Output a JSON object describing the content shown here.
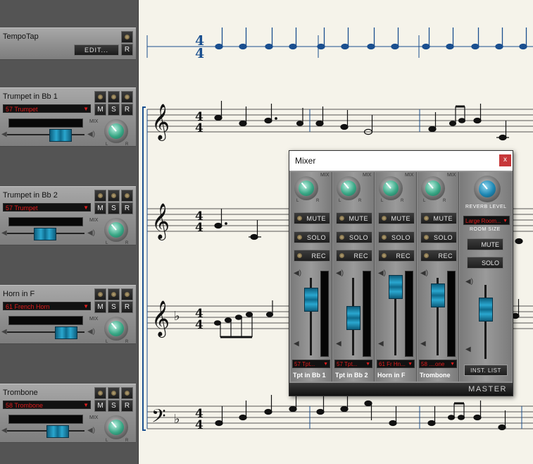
{
  "tempo_track": {
    "name": "TempoTap",
    "edit_label": "EDIT...",
    "r_label": "R"
  },
  "tracks": [
    {
      "name": "Trumpet in Bb 1",
      "patch": "57 Trumpet",
      "m": "M",
      "s": "S",
      "r": "R",
      "mix": "MIX",
      "l": "L",
      "rr": "R",
      "fader": 0.62
    },
    {
      "name": "Trumpet in Bb 2",
      "patch": "57 Trumpet",
      "m": "M",
      "s": "S",
      "r": "R",
      "mix": "MIX",
      "l": "L",
      "rr": "R",
      "fader": 0.5
    },
    {
      "name": "Horn in F",
      "patch": "61 French Horn",
      "m": "M",
      "s": "S",
      "r": "R",
      "mix": "MIX",
      "l": "L",
      "rr": "R",
      "fader": 0.72
    },
    {
      "name": "Trombone",
      "patch": "58 Trombone",
      "m": "M",
      "s": "S",
      "r": "R",
      "mix": "MIX",
      "l": "L",
      "rr": "R",
      "fader": 0.6
    }
  ],
  "score": {
    "time_signature_top": "4",
    "time_signature_bottom": "4"
  },
  "mixer": {
    "title": "Mixer",
    "close_label": "x",
    "strips": [
      {
        "name": "Tpt in Bb 1",
        "patch": "57 Tpt...",
        "mute": "MUTE",
        "solo": "SOLO",
        "rec": "REC",
        "mix": "MIX",
        "l": "L",
        "r": "R",
        "fader": 0.72
      },
      {
        "name": "Tpt in Bb 2",
        "patch": "57 Tpt...",
        "mute": "MUTE",
        "solo": "SOLO",
        "rec": "REC",
        "mix": "MIX",
        "l": "L",
        "r": "R",
        "fader": 0.55
      },
      {
        "name": "Horn in F",
        "patch": "61 Fr Hn...",
        "mute": "MUTE",
        "solo": "SOLO",
        "rec": "REC",
        "mix": "MIX",
        "l": "L",
        "r": "R",
        "fader": 0.82
      },
      {
        "name": "Trombone",
        "patch": "58 ....one",
        "mute": "MUTE",
        "solo": "SOLO",
        "rec": "REC",
        "mix": "MIX",
        "l": "L",
        "r": "R",
        "fader": 0.7
      }
    ],
    "master": {
      "label": "MASTER",
      "reverb_label": "REVERB LEVEL",
      "room_value": "Large Room...",
      "room_label": "ROOM SIZE",
      "mute": "MUTE",
      "solo": "SOLO",
      "inst_list": "INST. LIST",
      "fader": 0.6
    },
    "accent_color": "#2aa7cf"
  }
}
